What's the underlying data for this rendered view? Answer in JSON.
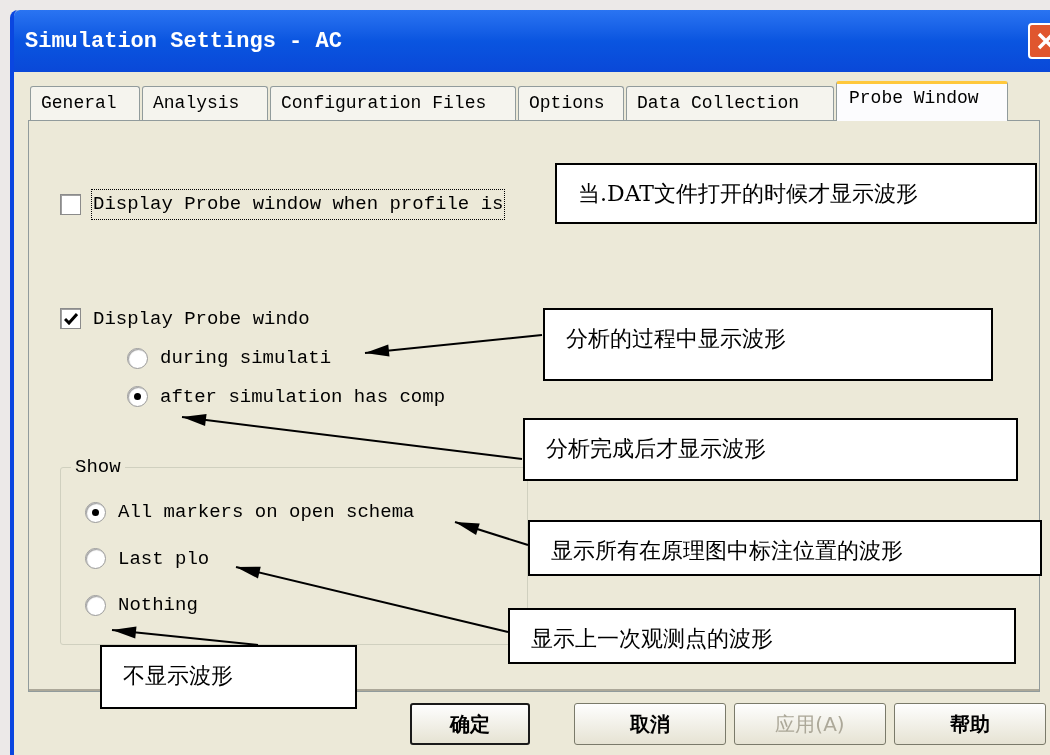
{
  "window": {
    "title": "Simulation Settings - AC"
  },
  "tabs": [
    {
      "label": "General",
      "selected": false
    },
    {
      "label": "Analysis",
      "selected": false
    },
    {
      "label": "Configuration Files",
      "selected": false
    },
    {
      "label": "Options",
      "selected": false
    },
    {
      "label": "Data Collection",
      "selected": false
    },
    {
      "label": "Probe Window",
      "selected": true
    }
  ],
  "options": [
    {
      "kind": "checkbox",
      "label": "Display Probe window when profile is",
      "checked": false,
      "focused": true
    },
    {
      "kind": "checkbox",
      "label": "Display Probe windo",
      "checked": true,
      "focused": false
    },
    {
      "kind": "radio",
      "label": "during simulati",
      "selected": false
    },
    {
      "kind": "radio",
      "label": "after simulation has comp",
      "selected": true
    }
  ],
  "show_group": {
    "title": "Show",
    "options": [
      {
        "label": "All markers on open schema",
        "selected": true
      },
      {
        "label": "Last plo",
        "selected": false
      },
      {
        "label": "Nothing",
        "selected": false
      }
    ]
  },
  "annotations": [
    {
      "text": "当.DAT文件打开的时候才显示波形"
    },
    {
      "text": "分析的过程中显示波形"
    },
    {
      "text": "分析完成后才显示波形"
    },
    {
      "text": "显示所有在原理图中标注位置的波形"
    },
    {
      "text": "显示上一次观测点的波形"
    },
    {
      "text": "不显示波形"
    }
  ],
  "buttons": [
    {
      "label": "确定",
      "default": true,
      "disabled": false
    },
    {
      "label": "取消",
      "default": false,
      "disabled": false
    },
    {
      "label": "应用(A)",
      "default": false,
      "disabled": true
    },
    {
      "label": "帮助",
      "default": false,
      "disabled": false
    }
  ]
}
